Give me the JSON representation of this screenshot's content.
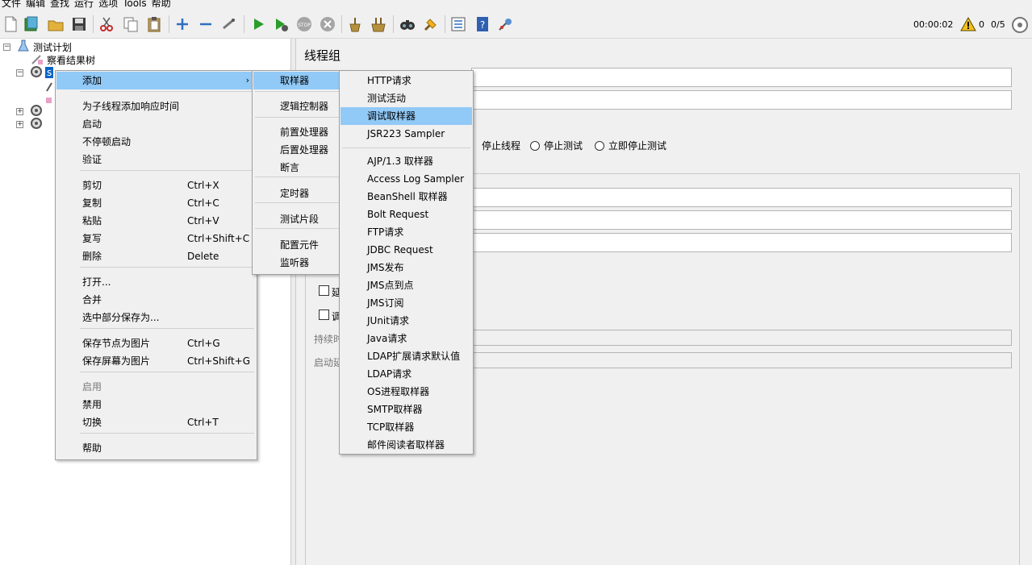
{
  "menubar": [
    "文件",
    "编辑",
    "查找",
    "运行",
    "选项",
    "Tools",
    "帮助"
  ],
  "status": {
    "timer": "00:00:02",
    "warnings": "0",
    "threads": "0/5"
  },
  "tree": {
    "root": "测试计划",
    "child1": "察看结果树",
    "selected": "s"
  },
  "editor": {
    "title": "线程组",
    "radio_labels": [
      "停止线程",
      "停止测试",
      "立即停止测试"
    ],
    "partial_labels": [
      "延",
      "调",
      "持续时",
      "启动延"
    ]
  },
  "context_menu": {
    "items": [
      {
        "label": "添加",
        "submenu": true,
        "highlight": true
      },
      {
        "label": "为子线程添加响应时间"
      },
      {
        "label": "启动"
      },
      {
        "label": "不停顿启动"
      },
      {
        "label": "验证"
      },
      {
        "label": "剪切",
        "shortcut": "Ctrl+X"
      },
      {
        "label": "复制",
        "shortcut": "Ctrl+C"
      },
      {
        "label": "粘贴",
        "shortcut": "Ctrl+V"
      },
      {
        "label": "复写",
        "shortcut": "Ctrl+Shift+C"
      },
      {
        "label": "删除",
        "shortcut": "Delete"
      },
      {
        "label": "打开..."
      },
      {
        "label": "合并"
      },
      {
        "label": "选中部分保存为..."
      },
      {
        "label": "保存节点为图片",
        "shortcut": "Ctrl+G"
      },
      {
        "label": "保存屏幕为图片",
        "shortcut": "Ctrl+Shift+G"
      },
      {
        "label": "启用",
        "disabled": true
      },
      {
        "label": "禁用"
      },
      {
        "label": "切换",
        "shortcut": "Ctrl+T"
      },
      {
        "label": "帮助"
      }
    ]
  },
  "add_submenu": {
    "items": [
      "取样器",
      "逻辑控制器",
      "前置处理器",
      "后置处理器",
      "断言",
      "定时器",
      "测试片段",
      "配置元件",
      "监听器"
    ]
  },
  "sampler_submenu": {
    "items": [
      "HTTP请求",
      "测试活动",
      "调试取样器",
      "JSR223 Sampler",
      "AJP/1.3 取样器",
      "Access Log Sampler",
      "BeanShell 取样器",
      "Bolt Request",
      "FTP请求",
      "JDBC Request",
      "JMS发布",
      "JMS点到点",
      "JMS订阅",
      "JUnit请求",
      "Java请求",
      "LDAP扩展请求默认值",
      "LDAP请求",
      "OS进程取样器",
      "SMTP取样器",
      "TCP取样器",
      "邮件阅读者取样器"
    ],
    "highlighted": "调试取样器"
  },
  "colors": {
    "highlight": "#91c9f7",
    "play": "#2a9d2a",
    "warning": "#f3c11b"
  }
}
